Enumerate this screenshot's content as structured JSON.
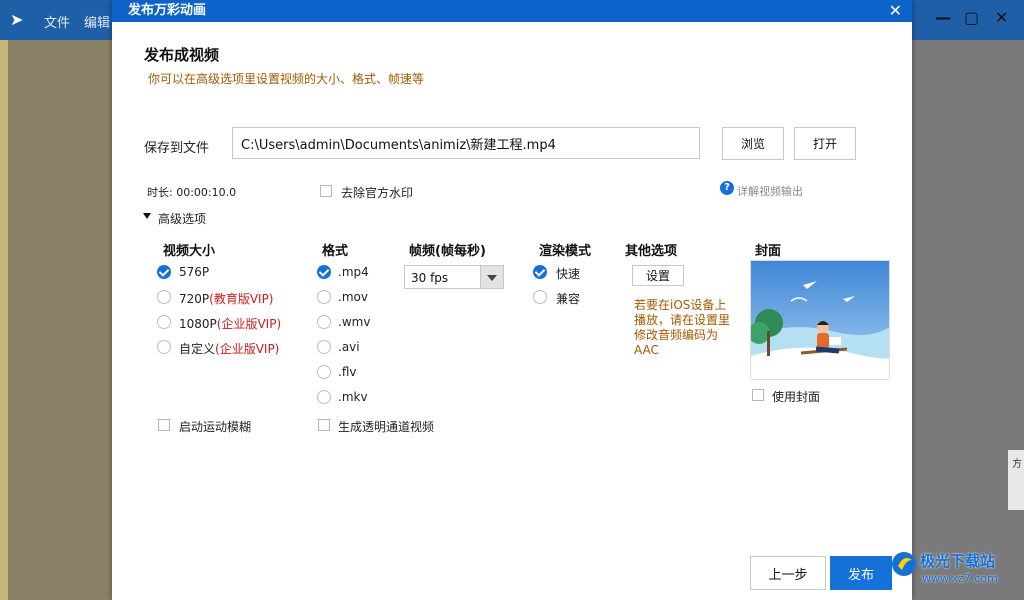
{
  "background_app": {
    "menu": [
      "文件",
      "编辑"
    ],
    "window_controls": [
      "—",
      "▢",
      "✕"
    ],
    "right_panel_text": "方"
  },
  "dialog": {
    "title": "发布万彩动画",
    "close_icon": "✕",
    "heading": "发布成视频",
    "subheading": "你可以在高级选项里设置视频的大小、格式、帧速等",
    "save_label": "保存到文件",
    "save_path": "C:\\Users\\admin\\Documents\\animiz\\新建工程.mp4",
    "browse_button": "浏览",
    "open_button": "打开",
    "duration_label": "时长: 00:00:10.0",
    "remove_watermark": "去除官方水印",
    "help_icon": "?",
    "help_text": "详解视频输出",
    "advanced_label": "高级选项",
    "columns": {
      "size": "视频大小",
      "format": "格式",
      "fps": "帧频(帧每秒)",
      "render": "渲染模式",
      "other": "其他选项",
      "cover": "封面"
    },
    "sizes": [
      {
        "label": "576P",
        "vip": "",
        "selected": true
      },
      {
        "label": "720P",
        "vip": "(教育版VIP)",
        "selected": false
      },
      {
        "label": "1080P",
        "vip": "(企业版VIP)",
        "selected": false
      },
      {
        "label": "自定义",
        "vip": "(企业版VIP)",
        "selected": false
      }
    ],
    "formats": [
      {
        "label": ".mp4",
        "selected": true
      },
      {
        "label": ".mov",
        "selected": false
      },
      {
        "label": ".wmv",
        "selected": false
      },
      {
        "label": ".avi",
        "selected": false
      },
      {
        "label": ".flv",
        "selected": false
      },
      {
        "label": ".mkv",
        "selected": false
      }
    ],
    "fps_value": "30 fps",
    "render_modes": [
      {
        "label": "快速",
        "selected": true
      },
      {
        "label": "兼容",
        "selected": false
      }
    ],
    "settings_button": "设置",
    "ios_note": "若要在iOS设备上播放，请在设置里修改音频编码为AAC",
    "use_cover": "使用封面",
    "motion_blur": "启动运动模糊",
    "transparent_video": "生成透明通道视频",
    "prev_button": "上一步",
    "publish_button": "发布"
  },
  "watermark_text": {
    "brand": "极光下载站",
    "url": "www.xz7.com"
  },
  "colors": {
    "title_bar": "#0d63c9",
    "accent": "#1570d8",
    "vip_red": "#d11a1a",
    "note_brown": "#a35a00"
  }
}
